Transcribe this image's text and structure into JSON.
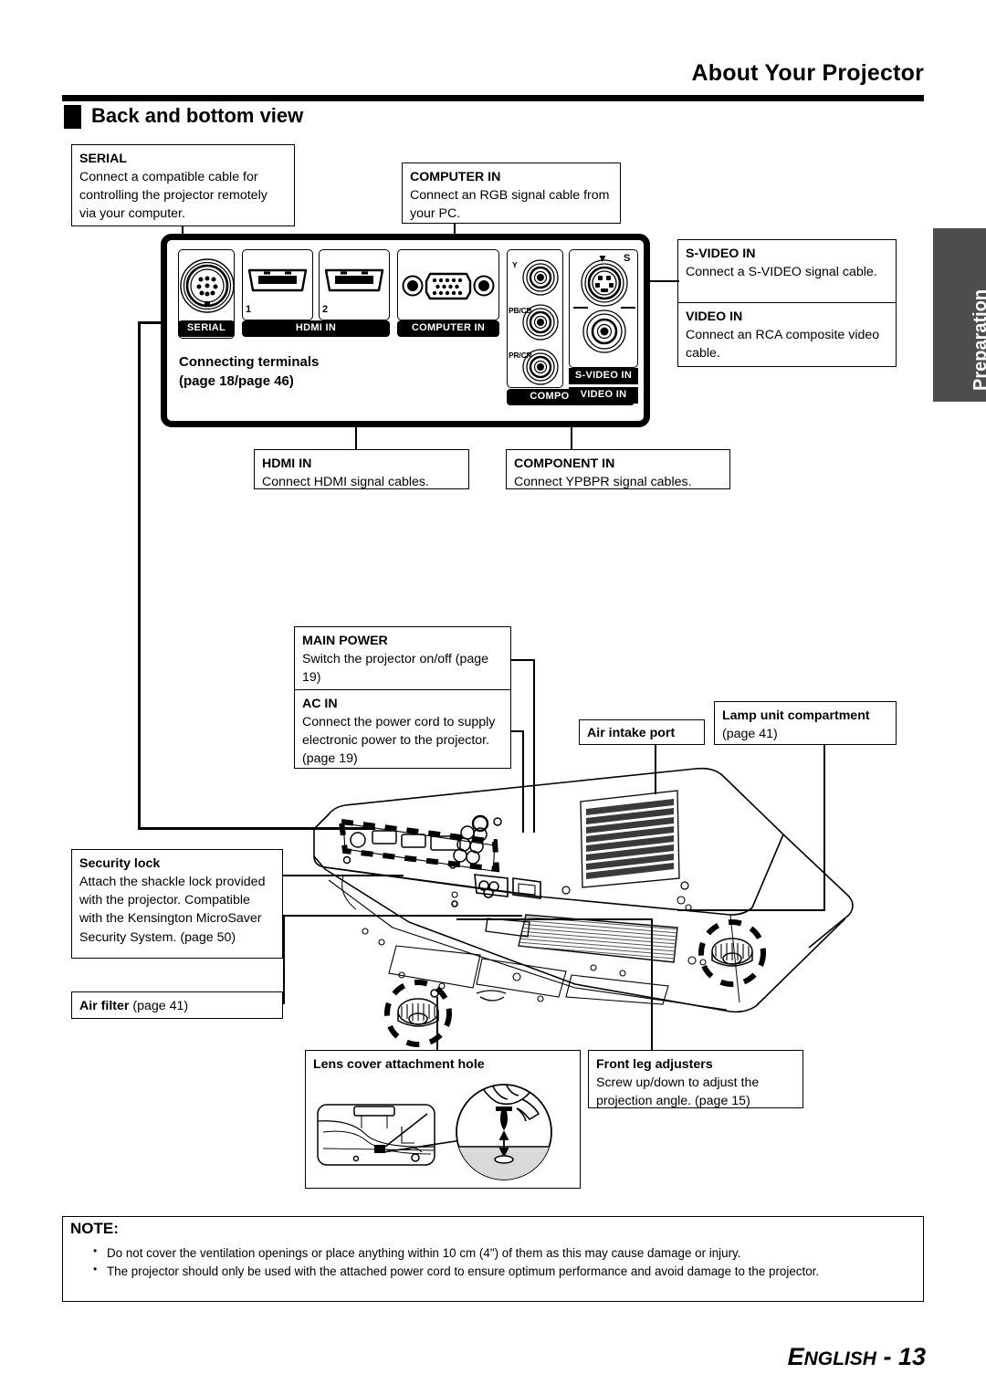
{
  "header": {
    "chapter_title": "About Your Projector",
    "section_title": "Back and bottom view"
  },
  "side_tab": {
    "label": "Preparation"
  },
  "callouts": {
    "serial": {
      "title": "SERIAL",
      "body": "Connect a compatible cable for controlling the projector remotely via your computer."
    },
    "computer_in": {
      "title": "COMPUTER IN",
      "body": "Connect an RGB signal cable from your PC."
    },
    "s_video_in": {
      "title": "S-VIDEO IN",
      "body": "Connect a S-VIDEO signal cable."
    },
    "video_in": {
      "title": "VIDEO IN",
      "body": "Connect an RCA composite video cable."
    },
    "hdmi_in": {
      "title": "HDMI IN",
      "body": "Connect HDMI signal cables."
    },
    "component_in": {
      "title": "COMPONENT IN",
      "body": "Connect YPBPR signal cables."
    },
    "main_power": {
      "title": "MAIN POWER",
      "body": "Switch the projector on/off (page 19)"
    },
    "ac_in": {
      "title": "AC IN",
      "body": "Connect the power cord to supply electronic power to the projector. (page 19)"
    },
    "air_intake_port": {
      "title": "Air intake port"
    },
    "lamp_unit": {
      "title": "Lamp unit compartment",
      "body": "(page 41)"
    },
    "security_lock": {
      "title": "Security lock",
      "body": "Attach the shackle lock provided with the projector. Compatible with the Kensington MicroSaver Security System. (page 50)"
    },
    "air_filter": {
      "title": "Air filter",
      "body": "(page 41)"
    },
    "lens_cover": {
      "title": "Lens cover attachment hole"
    },
    "front_leg": {
      "title": "Front leg adjusters",
      "body": "Screw up/down to adjust the projection angle. (page 15)"
    }
  },
  "terminal_panel": {
    "caption_line1": "Connecting terminals",
    "caption_line2": "(page 18/page 46)",
    "labels": {
      "serial": "SERIAL",
      "hdmi_in": "HDMI IN",
      "computer_in": "COMPUTER IN",
      "component_in": "COMPONENT IN",
      "s_video_in": "S-VIDEO IN",
      "video_in": "VIDEO IN"
    },
    "hdmi_port_1": "1",
    "hdmi_port_2": "2",
    "component_signals": [
      "Y",
      "PB/CB",
      "PR/CR"
    ],
    "svideo_marks": {
      "triangle": "▼",
      "s": "S"
    }
  },
  "note": {
    "title": "NOTE:",
    "items": [
      "Do not cover the ventilation openings or place anything within 10 cm (4\") of them as this may cause damage or injury.",
      "The projector should only be used with the attached power cord to ensure optimum performance and avoid damage to the projector."
    ]
  },
  "footer": {
    "language": "ENGLISH",
    "separator": " - ",
    "page_number": "13"
  },
  "colors": {
    "ink": "#000000",
    "tab_bg": "#4d4d4d",
    "tab_text": "#ffffff"
  }
}
